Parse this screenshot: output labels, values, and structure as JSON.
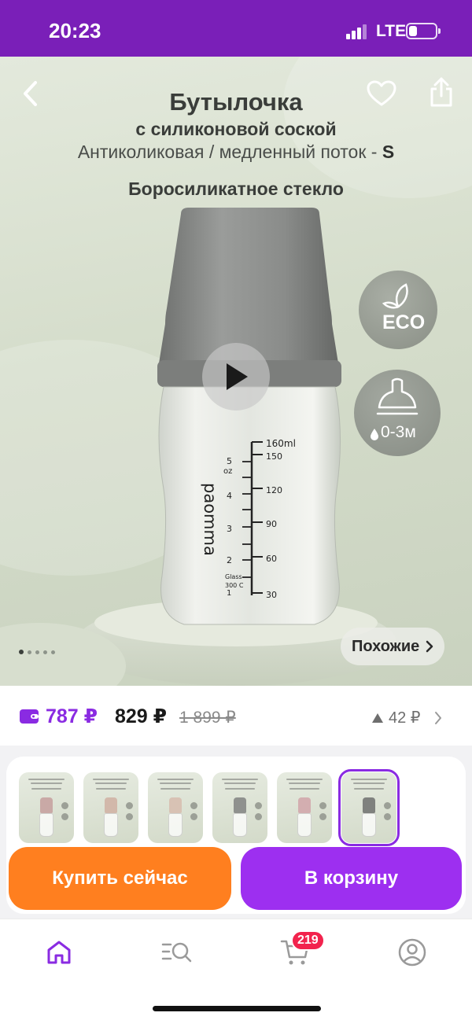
{
  "status_bar": {
    "time": "20:23",
    "network": "LTE",
    "battery_level": 0.3,
    "icons": [
      "signal-icon",
      "battery-icon"
    ]
  },
  "hero": {
    "title_line1": "Бутылочка",
    "title_line2": "с силиконовой соской",
    "title_line3": "Антиколиковая / медленный поток - ",
    "title_line3_accent": "S",
    "title_line4": "Боросиликатное стекло",
    "eco_label": "ECO",
    "age_label": "0-3м",
    "bottle_brand": "paomma",
    "scale_ml": [
      "160ml",
      "150",
      "120",
      "90",
      "60",
      "30"
    ],
    "scale_oz": [
      "5",
      "oz",
      "4",
      "3",
      "2",
      "Glass",
      "300 C",
      "1"
    ],
    "similar_label": "Похожие",
    "gallery_total": 5,
    "gallery_current": 1,
    "icons": [
      "back-icon",
      "heart-icon",
      "share-icon",
      "play-icon",
      "chevron-right-icon"
    ]
  },
  "price": {
    "wallet_price": "787 ₽",
    "price": "829 ₽",
    "old_price": "1 899 ₽",
    "delta": "42 ₽"
  },
  "variants": {
    "count": 6,
    "selected_index": 5,
    "cap_colors": [
      "#c9a9a6",
      "#d2b8aa",
      "#d8c2b4",
      "#8f918e",
      "#d3aeb0",
      "#7f817e"
    ]
  },
  "actions": {
    "buy_now": "Купить сейчас",
    "add_to_cart": "В корзину"
  },
  "bottom_nav": {
    "cart_count": "219",
    "active": "home",
    "accent_color": "#8a2be2"
  },
  "colors": {
    "brand": "#7a1fb8",
    "buy": "#ff7f1f",
    "cart": "#9d2ff0",
    "badge": "#f2234d"
  }
}
